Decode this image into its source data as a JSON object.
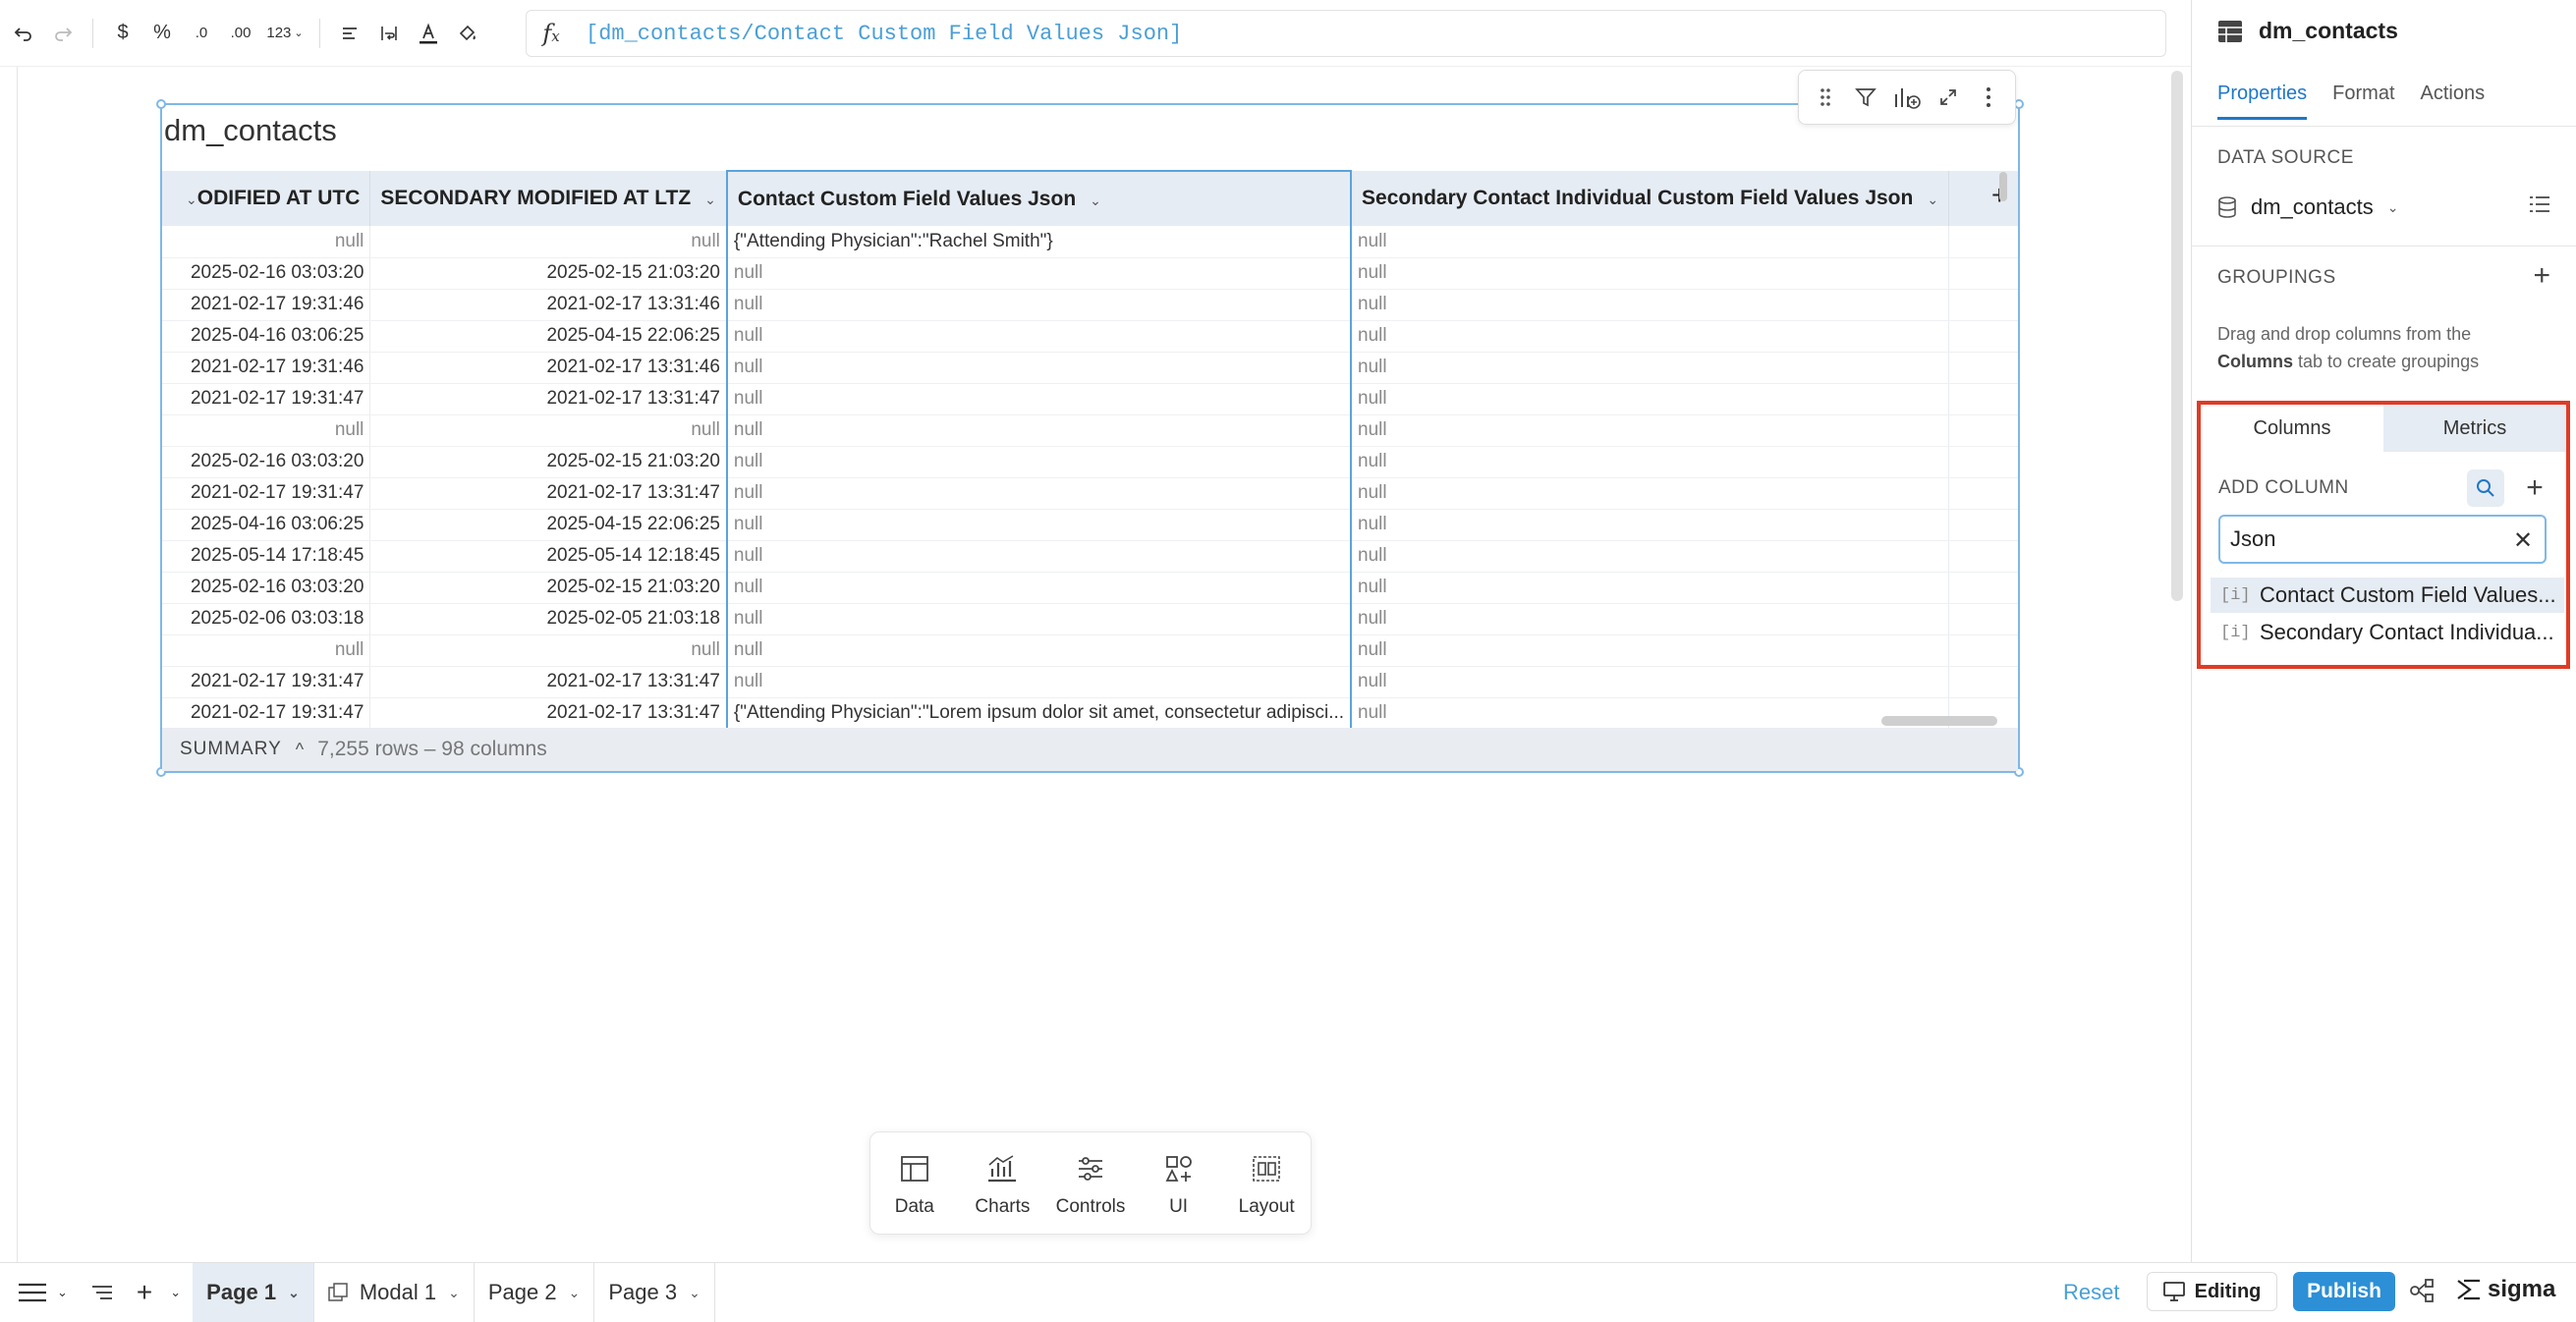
{
  "toolbar": {
    "format_currency": "$",
    "format_percent": "%",
    "format_decimal_less": ".0",
    "format_decimal_more": ".00",
    "format_number": "123",
    "formula_text": "[dm_contacts/Contact Custom Field Values Json]"
  },
  "element": {
    "title": "dm_contacts",
    "columns": [
      "ODIFIED AT UTC",
      "SECONDARY MODIFIED AT LTZ",
      "Contact Custom Field Values Json",
      "Secondary Contact Individual Custom Field Values Json"
    ],
    "rows": [
      [
        "null",
        "null",
        "{\"Attending Physician\":\"Rachel Smith\"}",
        "null"
      ],
      [
        "2025-02-16 03:03:20",
        "2025-02-15 21:03:20",
        "null",
        "null"
      ],
      [
        "2021-02-17 19:31:46",
        "2021-02-17 13:31:46",
        "null",
        "null"
      ],
      [
        "2025-04-16 03:06:25",
        "2025-04-15 22:06:25",
        "null",
        "null"
      ],
      [
        "2021-02-17 19:31:46",
        "2021-02-17 13:31:46",
        "null",
        "null"
      ],
      [
        "2021-02-17 19:31:47",
        "2021-02-17 13:31:47",
        "null",
        "null"
      ],
      [
        "null",
        "null",
        "null",
        "null"
      ],
      [
        "2025-02-16 03:03:20",
        "2025-02-15 21:03:20",
        "null",
        "null"
      ],
      [
        "2021-02-17 19:31:47",
        "2021-02-17 13:31:47",
        "null",
        "null"
      ],
      [
        "2025-04-16 03:06:25",
        "2025-04-15 22:06:25",
        "null",
        "null"
      ],
      [
        "2025-05-14 17:18:45",
        "2025-05-14 12:18:45",
        "null",
        "null"
      ],
      [
        "2025-02-16 03:03:20",
        "2025-02-15 21:03:20",
        "null",
        "null"
      ],
      [
        "2025-02-06 03:03:18",
        "2025-02-05 21:03:18",
        "null",
        "null"
      ],
      [
        "null",
        "null",
        "null",
        "null"
      ],
      [
        "2021-02-17 19:31:47",
        "2021-02-17 13:31:47",
        "null",
        "null"
      ],
      [
        "2021-02-17 19:31:47",
        "2021-02-17 13:31:47",
        "{\"Attending Physician\":\"Lorem ipsum dolor sit amet, consectetur adipisci...",
        "null"
      ]
    ],
    "summary_label": "SUMMARY",
    "summary_count": "7,255 rows – 98 columns"
  },
  "dock": {
    "items": [
      {
        "label": "Data",
        "icon": "table-icon"
      },
      {
        "label": "Charts",
        "icon": "chart-icon"
      },
      {
        "label": "Controls",
        "icon": "sliders-icon"
      },
      {
        "label": "UI",
        "icon": "shapes-icon"
      },
      {
        "label": "Layout",
        "icon": "layout-icon"
      }
    ]
  },
  "panel": {
    "title": "dm_contacts",
    "tabs": [
      "Properties",
      "Format",
      "Actions"
    ],
    "data_source_label": "DATA SOURCE",
    "data_source": "dm_contacts",
    "groupings_label": "GROUPINGS",
    "groupings_help_1": "Drag and drop columns from the ",
    "groupings_help_bold": "Columns",
    "groupings_help_2": " tab to create groupings",
    "col_tabs": [
      "Columns",
      "Metrics"
    ],
    "add_column_label": "ADD COLUMN",
    "search_value": "Json",
    "results": [
      "Contact Custom Field Values...",
      "Secondary Contact Individua..."
    ]
  },
  "bottom": {
    "pages": [
      "Page 1",
      "Modal 1",
      "Page 2",
      "Page 3"
    ],
    "reset": "Reset",
    "editing": "Editing",
    "publish": "Publish",
    "brand": "sigma"
  },
  "colors": {
    "accent": "#2d8fd5",
    "highlight_box": "#e03b24",
    "header_bg": "#e6ecf4",
    "link": "#4a9fd6"
  }
}
